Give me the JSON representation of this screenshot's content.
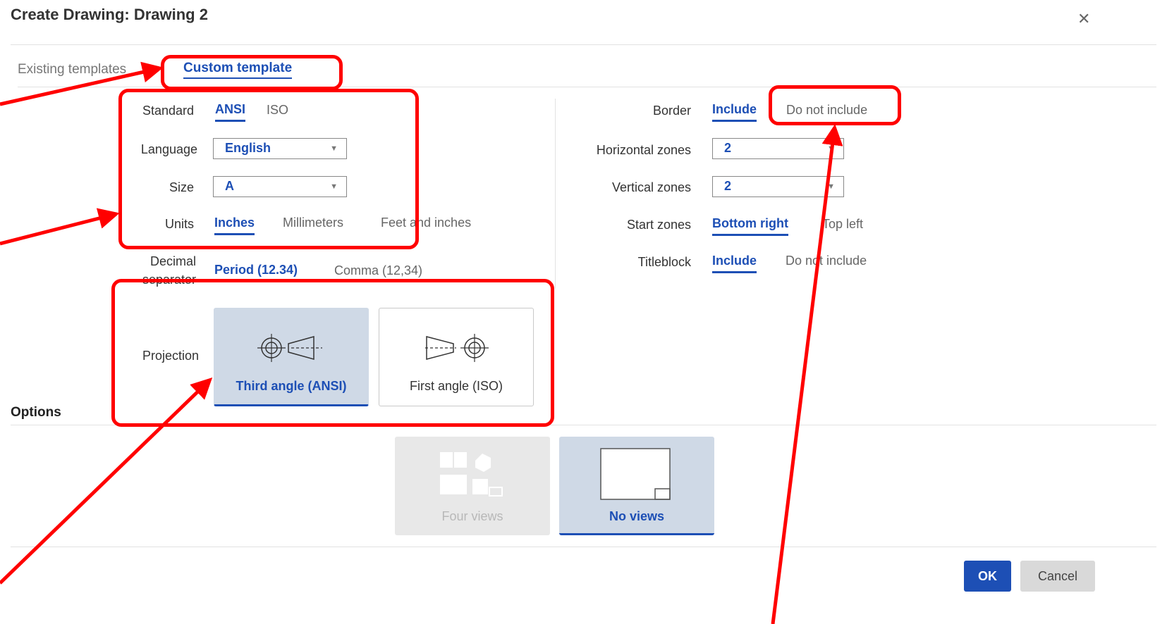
{
  "dialog": {
    "title": "Create Drawing: Drawing 2",
    "close_icon": "close-icon"
  },
  "tabs": [
    {
      "label": "Existing templates",
      "active": false
    },
    {
      "label": "Custom template",
      "active": true
    }
  ],
  "left": {
    "standard": {
      "label": "Standard",
      "options": [
        "ANSI",
        "ISO"
      ],
      "selected": "ANSI"
    },
    "language": {
      "label": "Language",
      "value": "English"
    },
    "size": {
      "label": "Size",
      "value": "A"
    },
    "units": {
      "label": "Units",
      "options": [
        "Inches",
        "Millimeters",
        "Feet and inches"
      ],
      "selected": "Inches"
    },
    "decimal": {
      "label_line1": "Decimal",
      "label_line2": "separator",
      "options": [
        "Period (12.34)",
        "Comma (12,34)"
      ],
      "selected": "Period (12.34)"
    },
    "projection": {
      "label": "Projection",
      "options": [
        {
          "label": "Third angle (ANSI)",
          "icon": "third-angle-projection-icon",
          "selected": true
        },
        {
          "label": "First angle (ISO)",
          "icon": "first-angle-projection-icon",
          "selected": false
        }
      ]
    }
  },
  "right": {
    "border": {
      "label": "Border",
      "options": [
        "Include",
        "Do not include"
      ],
      "selected": "Include"
    },
    "horizontal_zones": {
      "label": "Horizontal zones",
      "value": "2"
    },
    "vertical_zones": {
      "label": "Vertical zones",
      "value": "2"
    },
    "start_zones": {
      "label": "Start zones",
      "options": [
        "Bottom right",
        "Top left"
      ],
      "selected": "Bottom right"
    },
    "titleblock": {
      "label": "Titleblock",
      "options": [
        "Include",
        "Do not include"
      ],
      "selected": "Include"
    }
  },
  "options": {
    "heading": "Options",
    "views": [
      {
        "label": "Four views",
        "icon": "four-views-icon",
        "disabled": true
      },
      {
        "label": "No views",
        "icon": "no-views-icon",
        "selected": true
      }
    ]
  },
  "footer": {
    "ok": "OK",
    "cancel": "Cancel"
  },
  "colors": {
    "accent": "#1d4fb5",
    "selected_bg": "#cfd9e6",
    "annotation": "#ff0000"
  }
}
